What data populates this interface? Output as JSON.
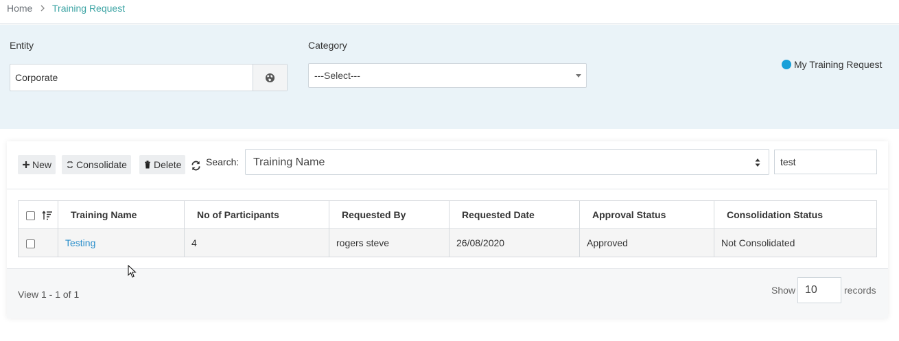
{
  "breadcrumb": {
    "home": "Home",
    "current": "Training Request",
    "separator_icon": "chevron-right-icon"
  },
  "filters": {
    "entity_label": "Entity",
    "entity_value": "Corporate",
    "entity_button_icon": "globe-icon",
    "category_label": "Category",
    "category_value": "---Select---",
    "my_training_label": "My Training Request"
  },
  "toolbar": {
    "new_label": "New",
    "consolidate_label": "Consolidate",
    "delete_label": "Delete",
    "search_label": "Search:",
    "search_field_value": "Training Name",
    "search_text": "test"
  },
  "table": {
    "columns": [
      "Training Name",
      "No of Participants",
      "Requested By",
      "Requested Date",
      "Approval Status",
      "Consolidation Status"
    ],
    "rows": [
      {
        "training_name": "Testing",
        "participants": "4",
        "requested_by": "rogers steve",
        "requested_date": "26/08/2020",
        "approval_status": "Approved",
        "consolidation_status": "Not Consolidated"
      }
    ]
  },
  "footer": {
    "view_text": "View 1 - 1 of 1",
    "show_label": "Show",
    "page_size": "10",
    "records_label": "records"
  },
  "colors": {
    "accent": "#18a0d9",
    "link": "#2a8ecb",
    "breadcrumb_active": "#3aa3a3",
    "panel_bg": "#eaf3f8"
  }
}
